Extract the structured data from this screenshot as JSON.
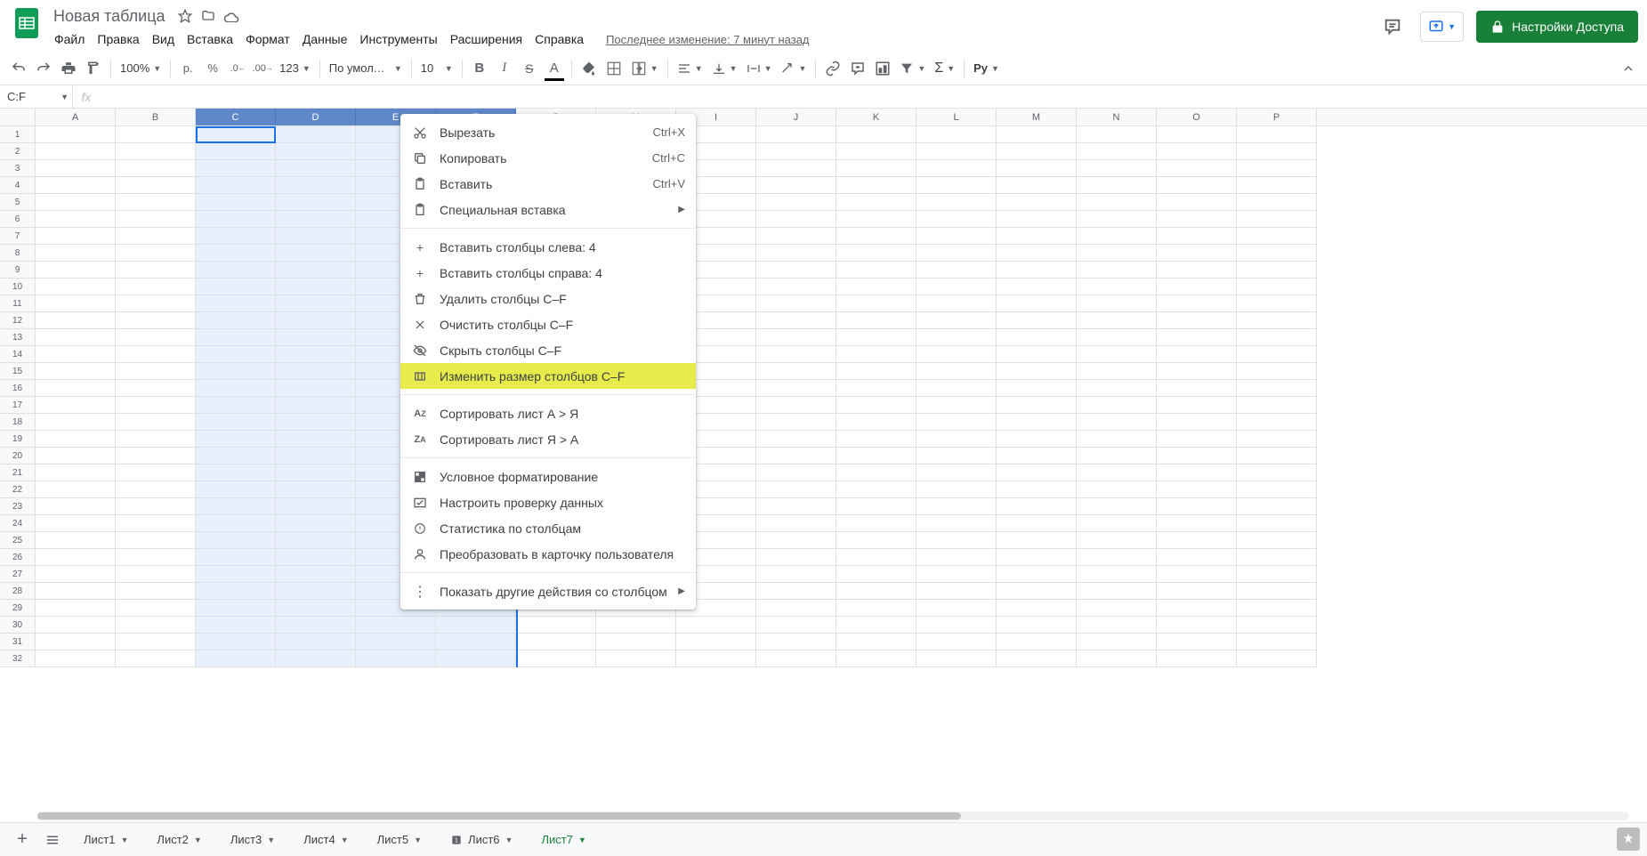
{
  "doc": {
    "title": "Новая таблица"
  },
  "menus": [
    "Файл",
    "Правка",
    "Вид",
    "Вставка",
    "Формат",
    "Данные",
    "Инструменты",
    "Расширения",
    "Справка"
  ],
  "last_edit": "Последнее изменение: 7 минут назад",
  "share_label": "Настройки Доступа",
  "toolbar": {
    "zoom": "100%",
    "currency": "р.",
    "percent": "%",
    "dec_dec": ".0",
    "inc_dec": ".00",
    "fmt123": "123",
    "font": "По умолча...",
    "size": "10",
    "py": "Py"
  },
  "name_box": "C:F",
  "columns": [
    "A",
    "B",
    "C",
    "D",
    "E",
    "F",
    "G",
    "H",
    "I",
    "J",
    "K",
    "L",
    "M",
    "N",
    "O",
    "P"
  ],
  "selected_cols": [
    "C",
    "D",
    "E",
    "F"
  ],
  "rows": 32,
  "context_menu": {
    "cut": {
      "label": "Вырезать",
      "shortcut": "Ctrl+X"
    },
    "copy": {
      "label": "Копировать",
      "shortcut": "Ctrl+C"
    },
    "paste": {
      "label": "Вставить",
      "shortcut": "Ctrl+V"
    },
    "paste_special": {
      "label": "Специальная вставка"
    },
    "insert_left": {
      "label": "Вставить столбцы слева: 4"
    },
    "insert_right": {
      "label": "Вставить столбцы справа: 4"
    },
    "delete": {
      "label": "Удалить столбцы C–F"
    },
    "clear": {
      "label": "Очистить столбцы C–F"
    },
    "hide": {
      "label": "Скрыть столбцы C–F"
    },
    "resize": {
      "label": "Изменить размер столбцов C–F"
    },
    "sort_az": {
      "label": "Сортировать лист А > Я"
    },
    "sort_za": {
      "label": "Сортировать лист Я > А"
    },
    "cond_fmt": {
      "label": "Условное форматирование"
    },
    "data_val": {
      "label": "Настроить проверку данных"
    },
    "col_stats": {
      "label": "Статистика по столбцам"
    },
    "convert_chip": {
      "label": "Преобразовать в карточку пользователя"
    },
    "more": {
      "label": "Показать другие действия со столбцом"
    }
  },
  "sheets": [
    {
      "name": "Лист1",
      "active": false,
      "icon": false
    },
    {
      "name": "Лист2",
      "active": false,
      "icon": false
    },
    {
      "name": "Лист3",
      "active": false,
      "icon": false
    },
    {
      "name": "Лист4",
      "active": false,
      "icon": false
    },
    {
      "name": "Лист5",
      "active": false,
      "icon": false
    },
    {
      "name": "Лист6",
      "active": false,
      "icon": true
    },
    {
      "name": "Лист7",
      "active": true,
      "icon": false
    }
  ]
}
